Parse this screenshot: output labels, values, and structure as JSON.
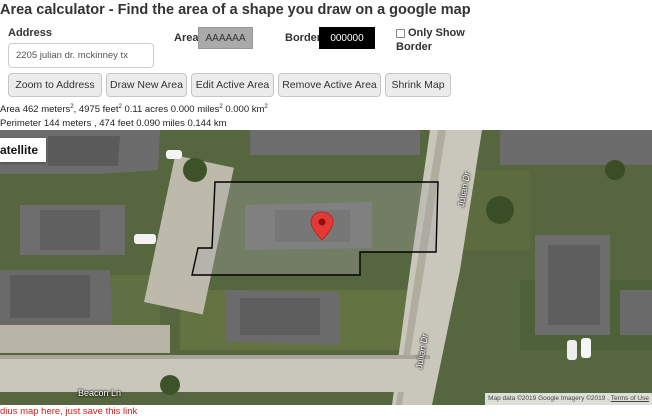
{
  "header": {
    "title": "Area calculator - Find the area of a shape you draw on a google map"
  },
  "form": {
    "address_label": "Address",
    "address_value": "2205 julian dr. mckinney tx",
    "area_label": "Area",
    "area_color": "AAAAAA",
    "border_label": "Border",
    "border_color": "000000",
    "only_show_line1": "Only Show",
    "only_show_line2": "Border",
    "only_show_checked": false
  },
  "toolbar": {
    "zoom_label": "Zoom to Address",
    "draw_label": "Draw New Area",
    "edit_label": "Edit Active Area",
    "remove_label": "Remove Active Area",
    "shrink_label": "Shrink Map"
  },
  "metrics": {
    "area_prefix": "Area",
    "area_meters": "462 meters",
    "area_feet": "4975 feet",
    "area_rest": "0.11 acres 0.000 miles",
    "area_km": "0.000 km",
    "sq": "2",
    "perimeter": "Perimeter 144 meters , 474 feet 0.090 miles 0.144 km"
  },
  "map": {
    "type_label": "atellite",
    "attribution": "Map data ©2019 Google Imagery ©2019 ,",
    "terms": "Terms of Use",
    "streets": {
      "julian_top": "Julian Dr",
      "julian_bottom": "Julian Dr",
      "beacon": "Beacon Ln"
    }
  },
  "footer": {
    "link_text": "dius map here, just save this link"
  },
  "colors": {
    "area_fill": "#aaaaaa",
    "border": "#000000",
    "marker": "#e53935",
    "link": "#d02020"
  }
}
